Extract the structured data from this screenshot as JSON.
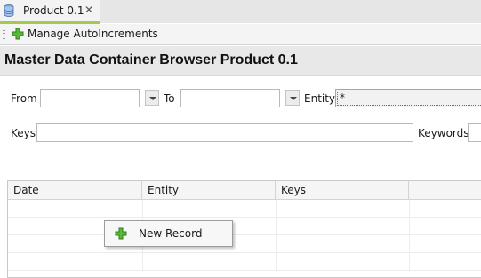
{
  "tab": {
    "title": "Product 0.1",
    "close_glyph": "✕",
    "icon": "database-icon"
  },
  "toolbar": {
    "manage_label": "Manage AutoIncrements",
    "manage_icon": "green-plus-icon"
  },
  "page": {
    "title": "Master Data Container Browser Product 0.1"
  },
  "filters": {
    "from_label": "From",
    "from_value": "",
    "to_label": "To",
    "to_value": "",
    "entity_label": "Entity",
    "entity_value": "*",
    "keys_label": "Keys",
    "keys_value": "",
    "keywords_label": "Keywords",
    "keywords_value": ""
  },
  "table": {
    "columns": [
      "Date",
      "Entity",
      "Keys"
    ],
    "rows": []
  },
  "context_menu": {
    "items": [
      {
        "label": "New Record",
        "icon": "green-plus-icon"
      }
    ]
  },
  "colors": {
    "tab_accent": "#a6c94a",
    "plus_green": "#3e9a2a"
  }
}
